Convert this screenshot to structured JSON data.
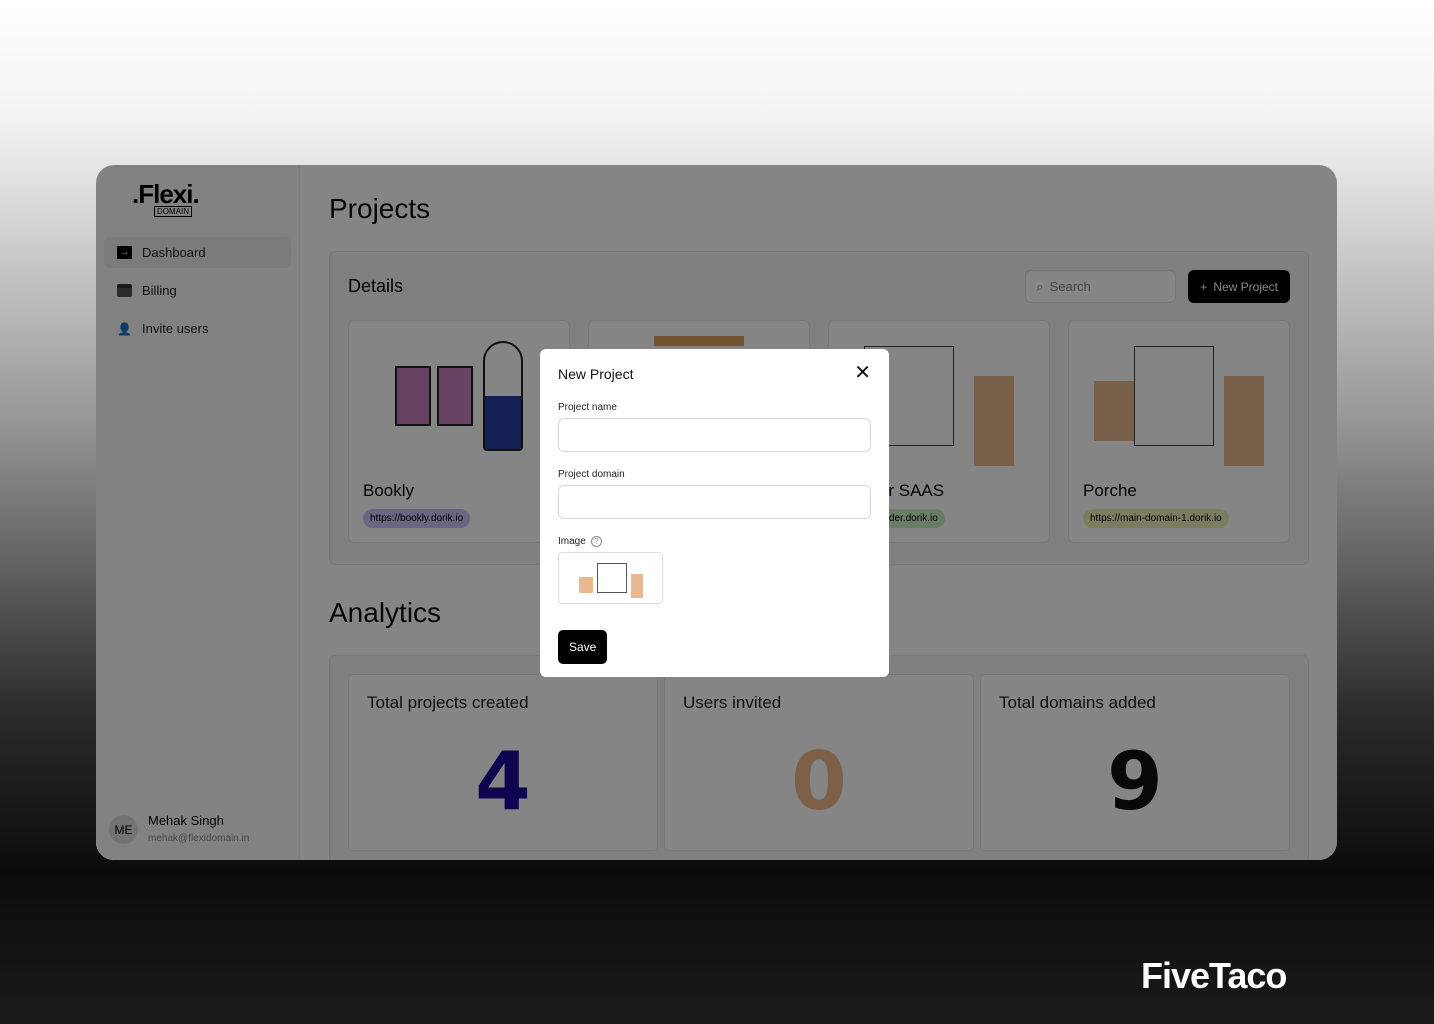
{
  "brand": "FiveTaco",
  "logo": {
    "name": ".Flexi.",
    "sub": "DOMAIN"
  },
  "sidebar": {
    "items": [
      {
        "label": "Dashboard",
        "icon": "arrow-right-square-icon",
        "active": true
      },
      {
        "label": "Billing",
        "icon": "credit-card-icon"
      },
      {
        "label": "Invite users",
        "icon": "user-add-icon"
      }
    ],
    "user": {
      "initials": "ME",
      "name": "Mehak Singh",
      "email": "mehak@flexidomain.in"
    }
  },
  "projects": {
    "title": "Projects",
    "details_title": "Details",
    "search_placeholder": "Search",
    "new_button": "New Project",
    "cards": [
      {
        "name": "Bookly",
        "url": "https://bookly.dorik.io",
        "color": "#c7c3f5"
      },
      {
        "name": "",
        "url": "",
        "color": "#eee"
      },
      {
        "name": "builder SAAS",
        "url": "blockbuilder.dorik.io",
        "color": "#c6efc1"
      },
      {
        "name": "Porche",
        "url": "https://main-domain-1.dorik.io",
        "color": "#eef0b8"
      }
    ]
  },
  "analytics": {
    "title": "Analytics",
    "stats": [
      {
        "label": "Total projects created",
        "value": "4",
        "color": "#1a0a99"
      },
      {
        "label": "Users invited",
        "value": "0",
        "color": "#f0b98a"
      },
      {
        "label": "Total domains added",
        "value": "9",
        "color": "#111111"
      }
    ]
  },
  "modal": {
    "title": "New Project",
    "name_label": "Project name",
    "domain_label": "Project domain",
    "image_label": "Image",
    "save": "Save"
  }
}
